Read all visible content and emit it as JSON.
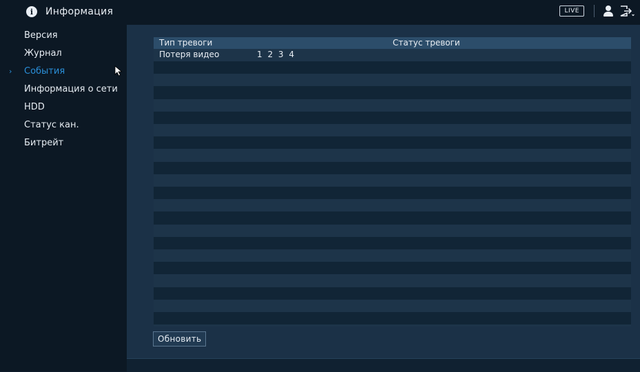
{
  "header": {
    "title": "Информация",
    "info_icon": "info-icon",
    "live_label": "LIVE",
    "user_icon": "user-icon",
    "logout_icon": "logout-icon"
  },
  "sidebar": {
    "items": [
      {
        "label": "Версия",
        "active": false
      },
      {
        "label": "Журнал",
        "active": false
      },
      {
        "label": "События",
        "active": true
      },
      {
        "label": "Информация о сети",
        "active": false
      },
      {
        "label": "HDD",
        "active": false
      },
      {
        "label": "Статус кан.",
        "active": false
      },
      {
        "label": "Битрейт",
        "active": false
      }
    ],
    "active_indicator": "chevron-right-icon"
  },
  "table": {
    "columns": [
      "Тип тревоги",
      "Статус тревоги"
    ],
    "rows": [
      {
        "type": "Потеря видео",
        "status": "1 2 3 4"
      }
    ]
  },
  "actions": {
    "refresh_label": "Обновить"
  },
  "colors": {
    "accent": "#2a8fd9",
    "sidebar_bg": "#0c1824",
    "panel_bg": "#1b3147",
    "table_header_bg": "#2c4d6a"
  }
}
